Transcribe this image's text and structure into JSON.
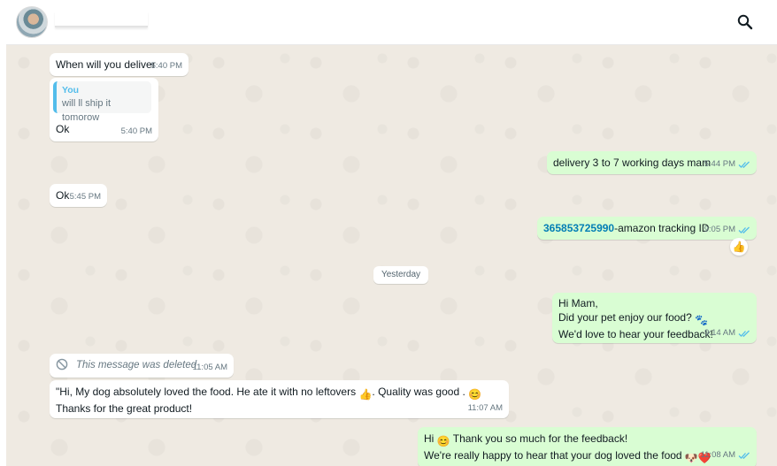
{
  "header": {
    "contact_name": "",
    "search_icon": "search-icon"
  },
  "messages": {
    "m1": {
      "text": "When will you deliver",
      "time": "5:40 PM"
    },
    "m2": {
      "quote_author": "You",
      "quote_text": "will ll ship it tomorow",
      "text": "Ok",
      "time": "5:40 PM"
    },
    "m3": {
      "text": "delivery 3 to 7 working days mam",
      "time": "5:44 PM"
    },
    "m4": {
      "text": "Ok",
      "time": "5:45 PM"
    },
    "m5": {
      "tracking_number": "365853725990",
      "text": "-amazon tracking ID",
      "time": "9:05 PM",
      "reaction": "👍"
    },
    "date_divider": "Yesterday",
    "m6": {
      "line1": "Hi Mam,",
      "line2": "Did your pet enjoy our food?",
      "line2_emoji": "🐾",
      "line3": "We'd love to hear your feedback!",
      "time": "9:14 AM"
    },
    "m7": {
      "text": "This message was deleted",
      "time": "11:05 AM"
    },
    "m8": {
      "line1_a": "\"Hi, My  dog absolutely loved the food. He ate  it with no leftovers ",
      "line1_emoji1": "👍",
      "line1_b": ". Quality was good . ",
      "line1_emoji2": "😊",
      "line2": "Thanks for the great product!",
      "time": "11:07 AM"
    },
    "m9": {
      "line1_a": "Hi ",
      "line1_emoji": "😊",
      "line1_b": " Thank you so much for the feedback!",
      "line2": "We're really happy to hear that your dog loved the food ",
      "line2_emoji1": "🐶",
      "line2_emoji2": "❤️",
      "time": "11:08 AM"
    }
  },
  "colors": {
    "chat_bg": "#efeae2",
    "incoming": "#ffffff",
    "outgoing": "#d9fdd3",
    "read_ticks": "#53bdeb"
  }
}
